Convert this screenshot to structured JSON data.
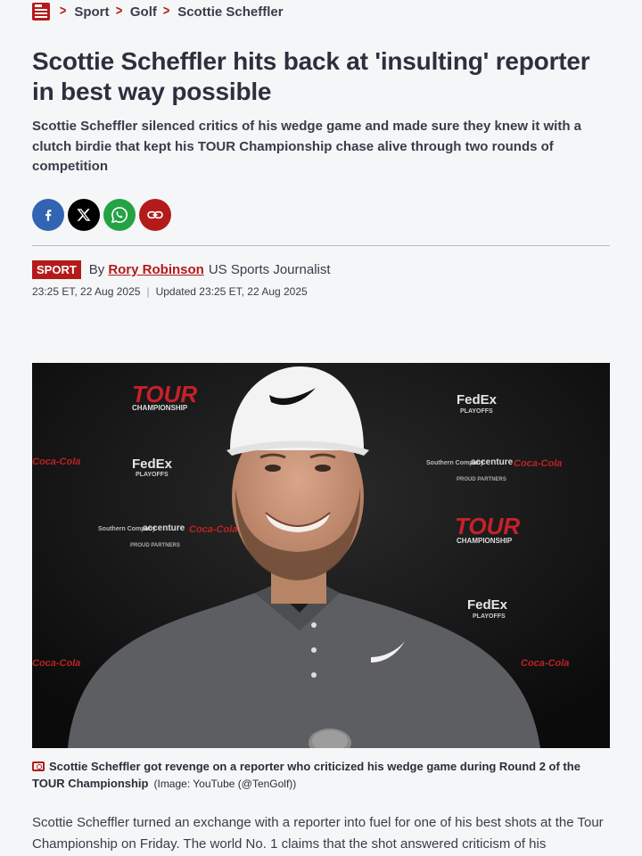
{
  "breadcrumb": {
    "items": [
      "Sport",
      "Golf",
      "Scottie Scheffler"
    ]
  },
  "article": {
    "headline": "Scottie Scheffler hits back at 'insulting' reporter in best way possible",
    "standfirst": "Scottie Scheffler silenced critics of his wedge game and made sure they knew it with a clutch birdie that kept his TOUR Championship chase alive through two rounds of competition",
    "section_tag": "SPORT",
    "by_label": "By",
    "author": "Rory Robinson",
    "author_role": "US Sports Journalist",
    "published": "23:25 ET, 22 Aug 2025",
    "updated": "Updated 23:25 ET, 22 Aug 2025",
    "caption": "Scottie Scheffler got revenge on a reporter who criticized his wedge game during Round 2 of the TOUR Championship",
    "image_credit": "(Image: YouTube (@TenGolf))",
    "body_first": "Scottie Scheffler turned an exchange with a reporter into fuel for one of his best shots at the Tour Championship on Friday. The world No. 1 claims that the shot answered criticism of his"
  },
  "share": [
    "facebook-icon",
    "x-icon",
    "whatsapp-icon",
    "link-icon"
  ],
  "photo_signage": {
    "tour": "TOUR",
    "championship": "CHAMPIONSHIP",
    "fedex": "FedEx",
    "playoffs": "PLAYOFFS",
    "southern": "Southern Company",
    "accenture": "accenture",
    "cocacola": "Coca-Cola",
    "partners": "PROUD PARTNERS"
  },
  "colors": {
    "accent": "#b31b1b",
    "facebook": "#3164b2",
    "whatsapp": "#25a244",
    "text": "#2b2d3a"
  }
}
